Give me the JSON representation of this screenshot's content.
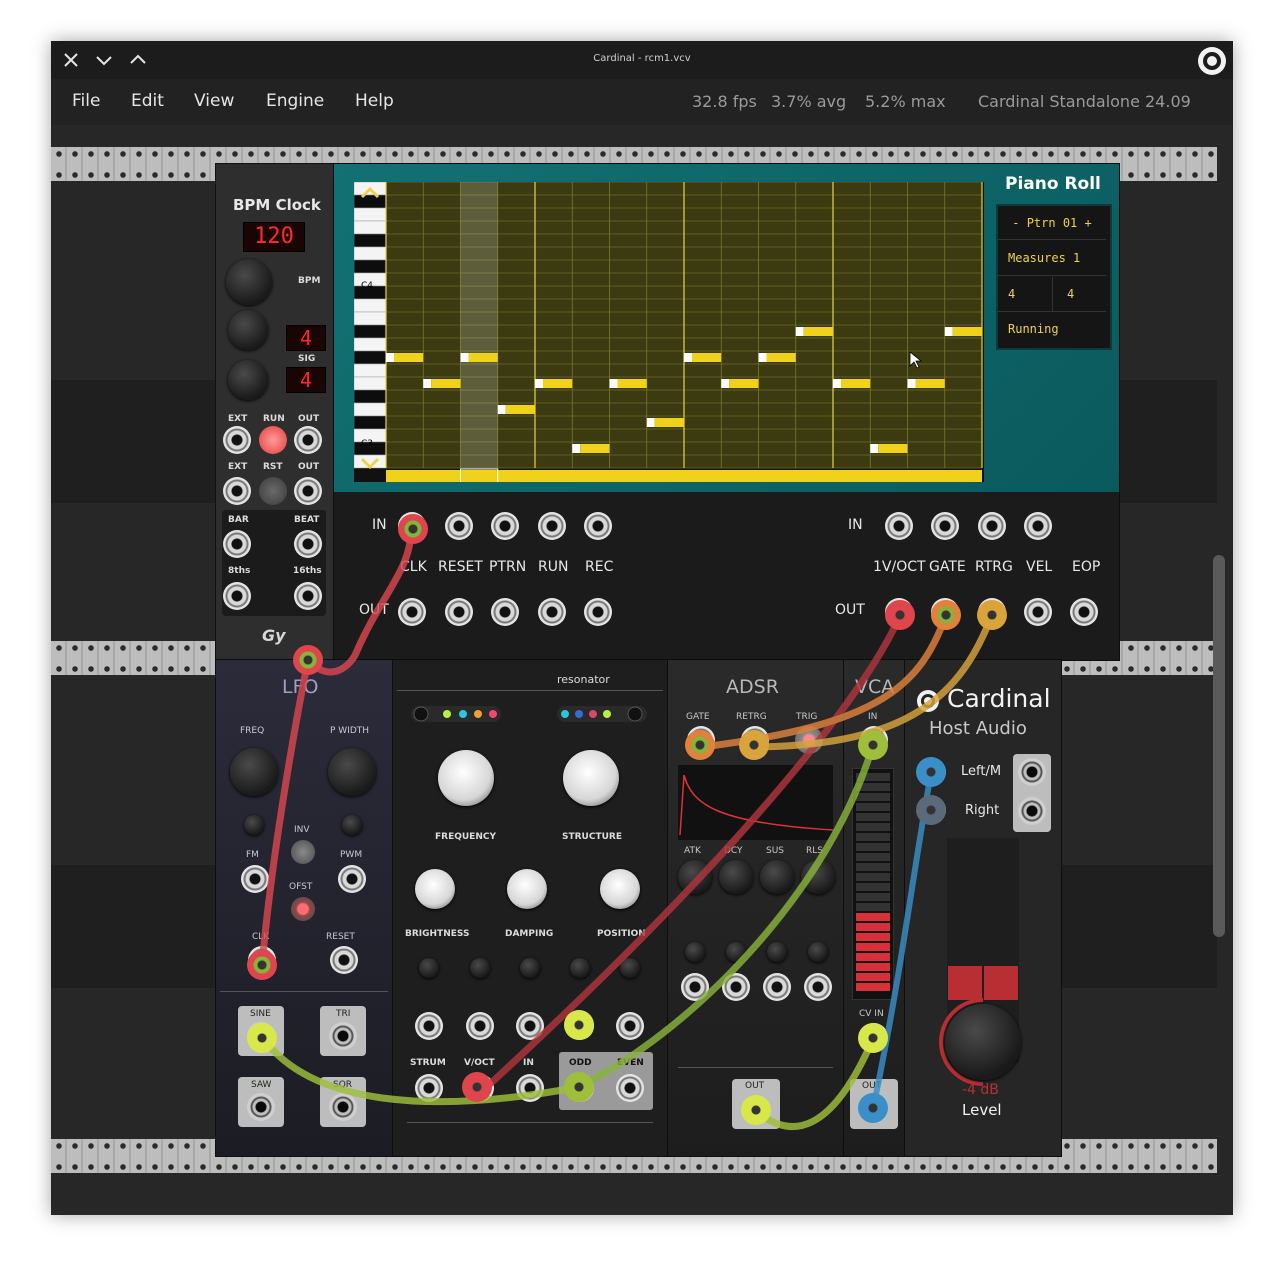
{
  "window": {
    "title": "Cardinal - rcm1.vcv",
    "close_icon": "close-icon",
    "minimize_icon": "chevron-down-icon",
    "maximize_icon": "chevron-up-icon",
    "app_icon": "cardinal-logo-icon"
  },
  "menu": {
    "items": [
      "File",
      "Edit",
      "View",
      "Engine",
      "Help"
    ],
    "fps": "32.8 fps",
    "avg": "3.7% avg",
    "max": "5.2% max",
    "version": "Cardinal Standalone 24.09"
  },
  "bpm_clock": {
    "title": "BPM Clock",
    "bpm_display": "120",
    "bpm_label": "BPM",
    "sig_top": "4",
    "sig_bottom": "4",
    "sig_label": "SIG",
    "row1": [
      "EXT",
      "RUN",
      "OUT"
    ],
    "row2": [
      "EXT",
      "RST",
      "OUT"
    ],
    "bar": "BAR",
    "beat": "BEAT",
    "eighths": "8ths",
    "sixteenths": "16ths"
  },
  "piano_roll": {
    "title": "Piano Roll",
    "pattern": "- Ptrn 01 +",
    "measures": "Measures 1",
    "time_num": "4",
    "time_den": "4",
    "status": "Running",
    "c4": "C4",
    "c3": "C3",
    "in_label": "IN",
    "out_label": "OUT",
    "left_labels": [
      "CLK",
      "RESET",
      "PTRN",
      "RUN",
      "REC"
    ],
    "right_in_label": "IN",
    "right_labels": [
      "1V/OCT",
      "GATE",
      "RTRG",
      "VEL",
      "EOP"
    ],
    "right_out_label": "OUT",
    "notes": [
      {
        "step": 0,
        "row": 13
      },
      {
        "step": 2,
        "row": 15
      },
      {
        "step": 4,
        "row": 13
      },
      {
        "step": 6,
        "row": 17
      },
      {
        "step": 8,
        "row": 15
      },
      {
        "step": 10,
        "row": 20
      },
      {
        "step": 12,
        "row": 15
      },
      {
        "step": 14,
        "row": 18
      },
      {
        "step": 16,
        "row": 13
      },
      {
        "step": 18,
        "row": 15
      },
      {
        "step": 20,
        "row": 13
      },
      {
        "step": 22,
        "row": 11
      },
      {
        "step": 24,
        "row": 15
      },
      {
        "step": 26,
        "row": 20
      },
      {
        "step": 28,
        "row": 15
      },
      {
        "step": 30,
        "row": 11
      }
    ],
    "playhead_step": 4
  },
  "lfo": {
    "title": "LFO",
    "freq": "FREQ",
    "pwidth": "P WIDTH",
    "fm": "FM",
    "inv": "INV",
    "pwm": "PWM",
    "ofst": "OFST",
    "clk": "CLK",
    "reset": "RESET",
    "sine": "SINE",
    "tri": "TRI",
    "saw": "SAW",
    "sqr": "SQR"
  },
  "resonator": {
    "title": "resonator",
    "frequency": "FREQUENCY",
    "structure": "STRUCTURE",
    "brightness": "BRIGHTNESS",
    "damping": "DAMPING",
    "position": "POSITION",
    "strum": "STRUM",
    "voct": "V/OCT",
    "in": "IN",
    "odd": "ODD",
    "even": "EVEN"
  },
  "adsr": {
    "title": "ADSR",
    "gate": "GATE",
    "retrg": "RETRG",
    "trig": "TRIG",
    "atk": "ATK",
    "dcy": "DCY",
    "sus": "SUS",
    "rls": "RLS",
    "out": "OUT"
  },
  "vca": {
    "title": "VCA",
    "in": "IN",
    "cv_in": "CV IN",
    "out": "OUT",
    "level": 0.35
  },
  "host_audio": {
    "brand": "Cardinal",
    "subtitle": "Host Audio",
    "left": "Left/M",
    "right": "Right",
    "db": "-4 dB",
    "level": "Level"
  }
}
